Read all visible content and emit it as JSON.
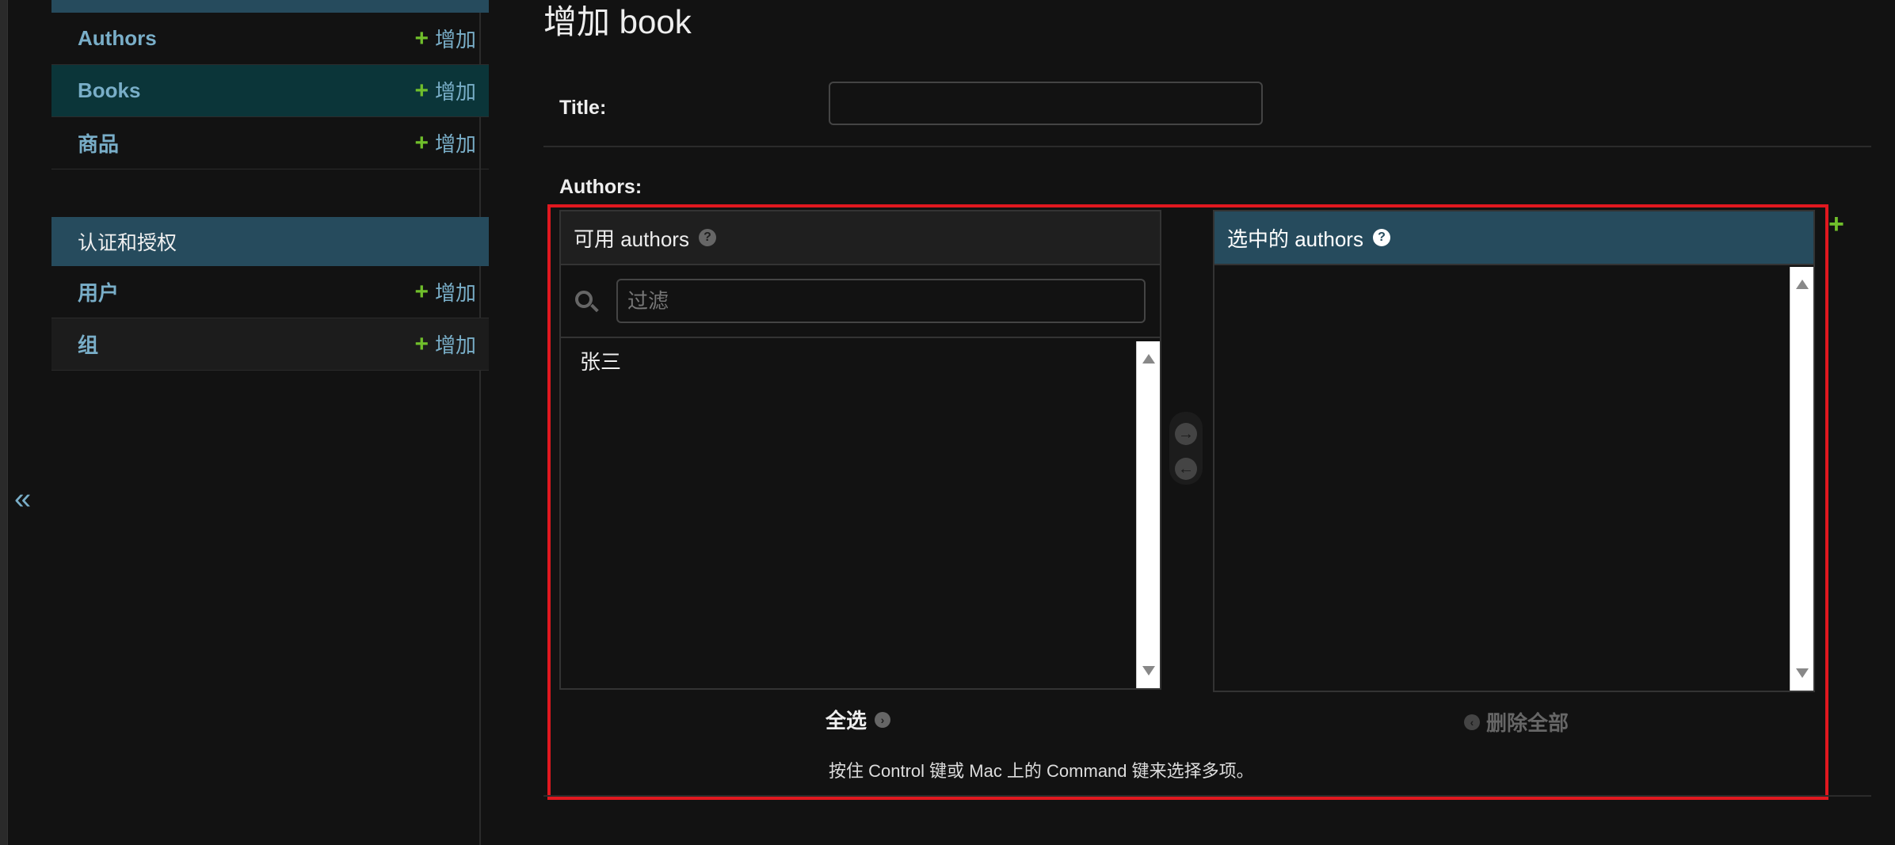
{
  "sidebar": {
    "collapse_label": "«",
    "app1_models": [
      {
        "name": "Authors",
        "add_label": "增加",
        "current": false
      },
      {
        "name": "Books",
        "add_label": "增加",
        "current": true
      },
      {
        "name": "商品",
        "add_label": "增加",
        "current": false
      }
    ],
    "app2_caption": "认证和授权",
    "app2_models": [
      {
        "name": "用户",
        "add_label": "增加"
      },
      {
        "name": "组",
        "add_label": "增加"
      }
    ],
    "plus_glyph": "+"
  },
  "main": {
    "page_title": "增加 book",
    "title_label": "Title:",
    "title_value": "",
    "authors_label": "Authors:",
    "available": {
      "header": "可用 authors",
      "filter_placeholder": "过滤",
      "options": [
        "张三"
      ]
    },
    "chosen": {
      "header": "选中的 authors",
      "options": []
    },
    "select_all_label": "全选",
    "remove_all_label": "删除全部",
    "help_text": "按住 Control 键或 Mac 上的 Command 键来选择多项。",
    "related_add_glyph": "+"
  },
  "colors": {
    "accent": "#79aec8",
    "header_bg": "#264b5d",
    "add_green": "#70bf2b",
    "highlight": "#e0181f"
  }
}
